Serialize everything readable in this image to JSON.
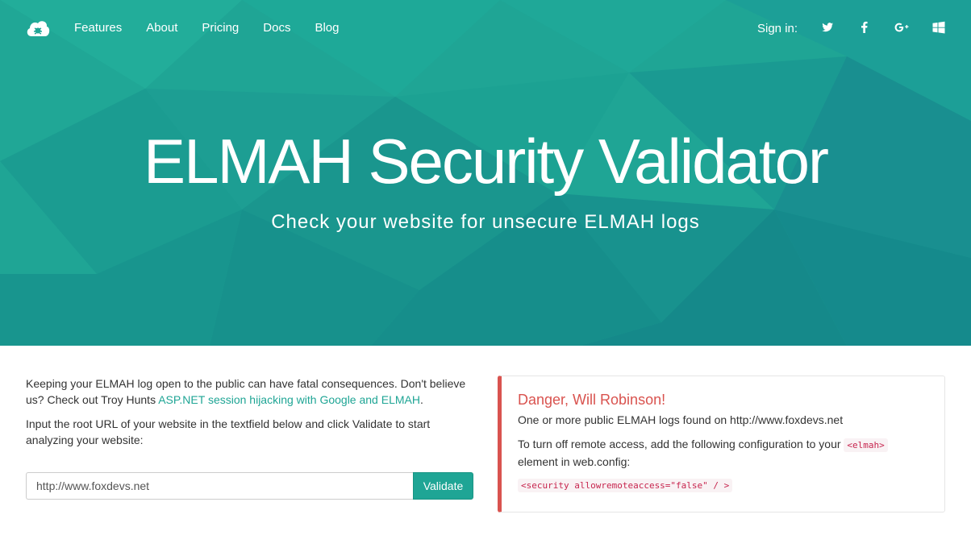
{
  "nav": {
    "logo_icon": "cloud-bug-icon",
    "links": [
      "Features",
      "About",
      "Pricing",
      "Docs",
      "Blog"
    ],
    "signin_label": "Sign in:",
    "social_icons": [
      "twitter-icon",
      "facebook-icon",
      "google-plus-icon",
      "windows-icon"
    ]
  },
  "hero": {
    "title": "ELMAH Security Validator",
    "subtitle": "Check your website for unsecure ELMAH logs",
    "bg_color": "#1fa595"
  },
  "intro": {
    "text_before_link": "Keeping your ELMAH log open to the public can have fatal consequences. Don't believe us? Check out Troy Hunts ",
    "link_text": "ASP.NET session hijacking with Google and ELMAH",
    "text_after_link": "."
  },
  "instructions": "Input the root URL of your website in the textfield below and click Validate to start analyzing your website:",
  "form": {
    "url_value": "http://www.foxdevs.net",
    "validate_label": "Validate"
  },
  "alert": {
    "title": "Danger, Will Robinson!",
    "found_text": "One or more public ELMAH logs found on http://www.foxdevs.net",
    "config_text_before": "To turn off remote access, add the following configuration to your ",
    "config_code": "<elmah>",
    "config_text_after": " element in web.config:",
    "security_code": "<security allowremoteaccess=\"false\" / >",
    "color": "#d9534f"
  }
}
